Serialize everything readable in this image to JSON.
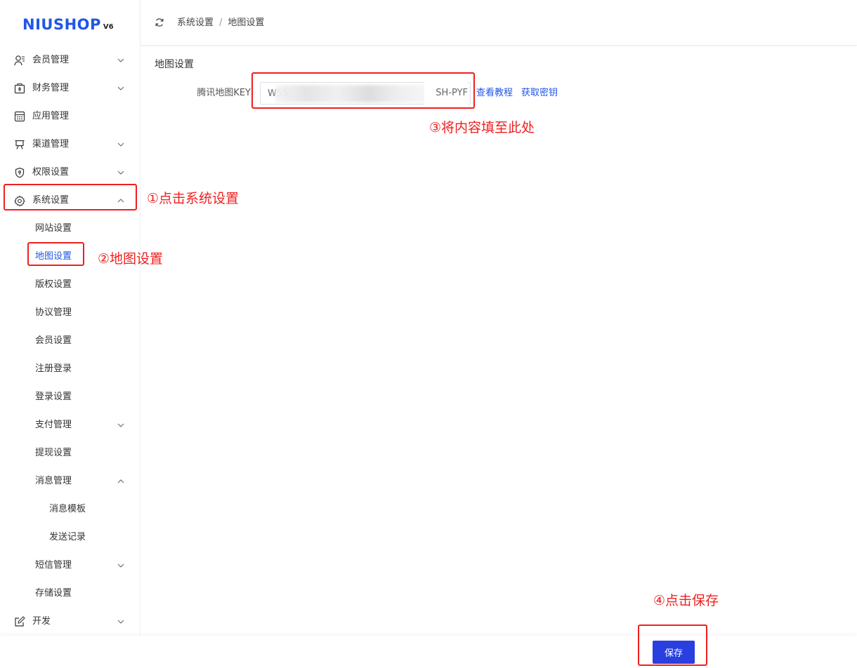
{
  "logo": {
    "brand": "NIUSHOP",
    "version": "V6"
  },
  "breadcrumb": {
    "parent": "系统设置",
    "separator": "/",
    "current": "地图设置"
  },
  "sidebar": {
    "items": [
      {
        "label": "会员管理"
      },
      {
        "label": "财务管理"
      },
      {
        "label": "应用管理"
      },
      {
        "label": "渠道管理"
      },
      {
        "label": "权限设置"
      },
      {
        "label": "系统设置"
      },
      {
        "label": "网站设置"
      },
      {
        "label": "地图设置"
      },
      {
        "label": "版权设置"
      },
      {
        "label": "协议管理"
      },
      {
        "label": "会员设置"
      },
      {
        "label": "注册登录"
      },
      {
        "label": "登录设置"
      },
      {
        "label": "支付管理"
      },
      {
        "label": "提现设置"
      },
      {
        "label": "消息管理"
      },
      {
        "label": "消息模板"
      },
      {
        "label": "发送记录"
      },
      {
        "label": "短信管理"
      },
      {
        "label": "存储设置"
      },
      {
        "label": "开发"
      }
    ]
  },
  "form": {
    "title": "地图设置",
    "key_label": "腾讯地图KEY",
    "key_value": "W55",
    "key_value_tail": "SH-PYF",
    "tutorial_link": "查看教程",
    "get_key_link": "获取密钥"
  },
  "footer": {
    "save_label": "保存"
  },
  "annotations": {
    "step1": "①点击系统设置",
    "step2": "②地图设置",
    "step3": "③将内容填至此处",
    "step4": "④点击保存"
  },
  "colors": {
    "accent": "#2056e6",
    "button": "#2a3fe0",
    "annotation": "#ef1f1f"
  }
}
